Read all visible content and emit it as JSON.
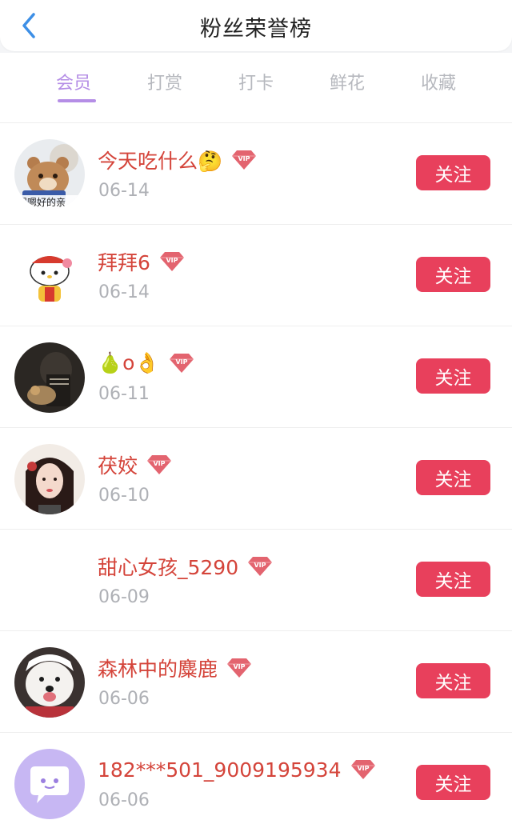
{
  "header": {
    "title": "粉丝荣誉榜",
    "back_icon": "chevron-left-icon"
  },
  "tabs": [
    {
      "label": "会员",
      "active": true
    },
    {
      "label": "打赏"
    },
    {
      "label": "打卡"
    },
    {
      "label": "鲜花"
    },
    {
      "label": "收藏"
    }
  ],
  "colors": {
    "accent": "#b58ee6",
    "name": "#d4443a",
    "follow_bg": "#e8405c",
    "vip_badge": "#e3646f"
  },
  "fans": [
    {
      "name": "今天吃什么🤔",
      "date": "06-14",
      "badge": "VIP",
      "avatar": "bear-avatar",
      "avatar_caption": "嗯嗯好的亲",
      "follow_label": "关注"
    },
    {
      "name": "拜拜6",
      "date": "06-14",
      "badge": "VIP",
      "avatar": "hello-kitty-avatar",
      "follow_label": "关注"
    },
    {
      "name": "🍐o👌",
      "date": "06-11",
      "badge": "VIP",
      "avatar": "dark-photo-avatar",
      "follow_label": "关注"
    },
    {
      "name": "茯姣",
      "date": "06-10",
      "badge": "VIP",
      "avatar": "girl-photo-avatar",
      "follow_label": "关注"
    },
    {
      "name": "甜心女孩_5290",
      "date": "06-09",
      "badge": "VIP",
      "avatar": "blank-avatar",
      "follow_label": "关注"
    },
    {
      "name": "森林中的麋鹿",
      "date": "06-06",
      "badge": "VIP",
      "avatar": "dog-photo-avatar",
      "follow_label": "关注"
    },
    {
      "name": "182***501_9009195934",
      "date": "06-06",
      "badge": "VIP",
      "avatar": "chat-bubble-avatar",
      "follow_label": "关注"
    }
  ]
}
